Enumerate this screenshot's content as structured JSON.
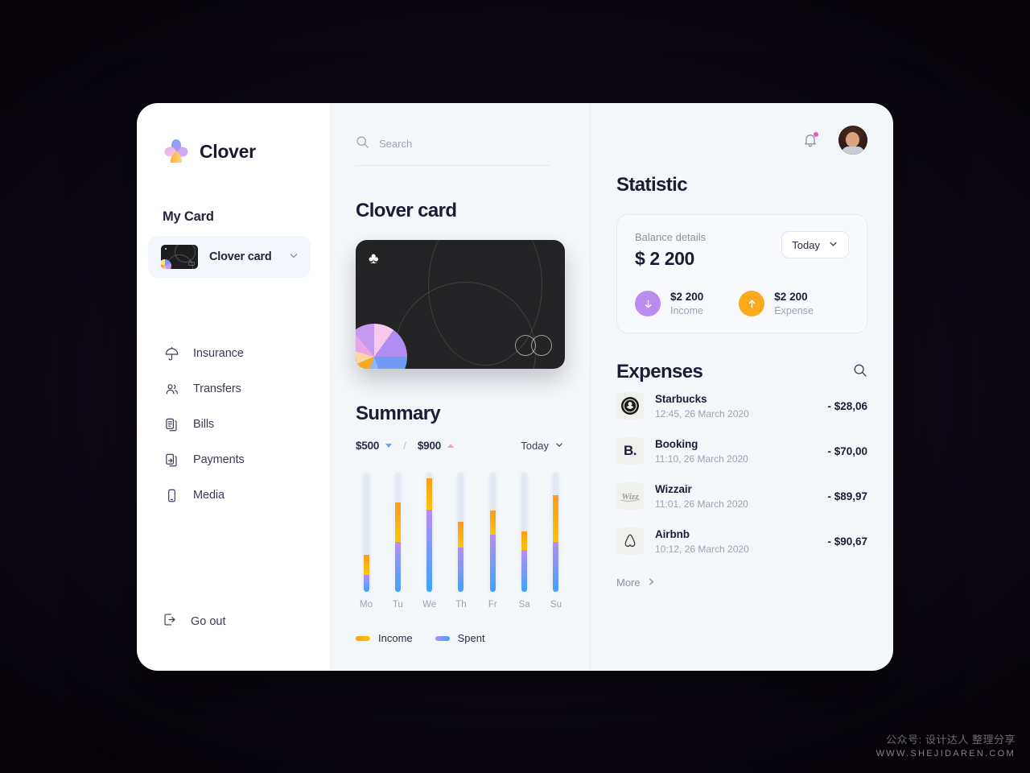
{
  "brand": {
    "name": "Clover",
    "logo_icon": "clover-logo-icon"
  },
  "sidebar": {
    "section_title": "My Card",
    "card_chip": {
      "label": "Clover card",
      "chevron_icon": "chevron-down-icon"
    },
    "items": [
      {
        "label": "Insurance",
        "icon": "umbrella-icon"
      },
      {
        "label": "Transfers",
        "icon": "people-icon"
      },
      {
        "label": "Bills",
        "icon": "documents-icon"
      },
      {
        "label": "Payments",
        "icon": "document-arrow-icon"
      },
      {
        "label": "Media",
        "icon": "phone-icon"
      }
    ],
    "logout": {
      "label": "Go out",
      "icon": "logout-icon"
    }
  },
  "search": {
    "placeholder": "Search",
    "icon": "search-icon",
    "value": ""
  },
  "header": {
    "notifications_icon": "bell-icon",
    "notification_dot_color": "#e855c4",
    "avatar": "user-avatar"
  },
  "card_panel": {
    "title": "Clover card",
    "suit_icon": "club-suit-icon",
    "payment_logo": "mastercard-circles-icon",
    "card_bg": "#232325"
  },
  "summary": {
    "title": "Summary",
    "left_value": "$500",
    "left_trend_icon": "triangle-down-icon",
    "left_trend_color": "#5aa9fb",
    "separator": "/",
    "right_value": "$900",
    "right_trend_icon": "triangle-up-icon",
    "right_trend_color": "#f79ac0",
    "period": "Today",
    "period_chevron_icon": "chevron-down-icon",
    "legend": [
      {
        "label": "Income",
        "color": "#fdb019"
      },
      {
        "label": "Spent",
        "color": "#8f9bf6"
      }
    ]
  },
  "chart_data": {
    "type": "bar",
    "title": "Summary",
    "categories": [
      "Mo",
      "Tu",
      "We",
      "Th",
      "Fr",
      "Sa",
      "Su"
    ],
    "series": [
      {
        "name": "Spent",
        "color": "#9b8df3",
        "values": [
          14,
          42,
          69,
          37,
          48,
          35,
          42
        ]
      },
      {
        "name": "Income",
        "color": "#fdb019",
        "values": [
          17,
          33,
          26,
          22,
          20,
          16,
          39
        ]
      }
    ],
    "stacked": true,
    "track_total": 100,
    "track_color": "#e3eaf2",
    "xlabel": "",
    "ylabel": "",
    "grid": false,
    "legend_position": "bottom"
  },
  "statistic": {
    "title": "Statistic",
    "balance_label": "Balance details",
    "balance_value": "$ 2 200",
    "period": "Today",
    "period_chevron_icon": "chevron-down-icon",
    "stats": [
      {
        "amount": "$2 200",
        "label": "Income",
        "icon": "arrow-down-icon",
        "color": "#bb8bf0"
      },
      {
        "amount": "$2 200",
        "label": "Expense",
        "icon": "arrow-up-icon",
        "color": "#fba91d"
      }
    ]
  },
  "expenses": {
    "title": "Expenses",
    "search_icon": "search-icon",
    "rows": [
      {
        "name": "Starbucks",
        "time": "12:45, 26 March 2020",
        "amount": "- $28,06",
        "logo": "starbucks-logo"
      },
      {
        "name": "Booking",
        "time": "11:10, 26 March 2020",
        "amount": "- $70,00",
        "logo": "booking-logo"
      },
      {
        "name": "Wizzair",
        "time": "11:01, 26 March 2020",
        "amount": "- $89,97",
        "logo": "wizzair-logo"
      },
      {
        "name": "Airbnb",
        "time": "10:12, 26 March 2020",
        "amount": "- $90,67",
        "logo": "airbnb-logo"
      }
    ],
    "more_label": "More",
    "more_icon": "chevron-right-icon"
  },
  "watermark": {
    "line1": "公众号: 设计达人 整理分享",
    "line2": "WWW.SHEJIDAREN.COM"
  }
}
